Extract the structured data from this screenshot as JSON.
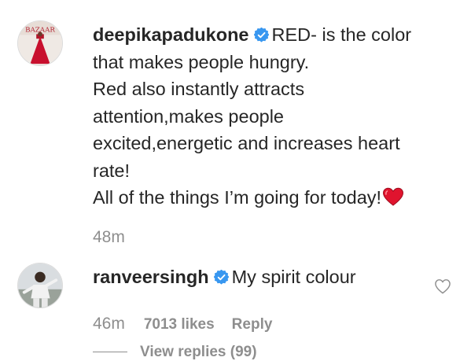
{
  "comments": [
    {
      "username": "deepikapadukone",
      "verified": true,
      "lines": [
        "RED- is the color",
        "that makes people hungry.",
        "Red also instantly attracts",
        "attention,makes people",
        "excited,energetic and increases heart",
        "rate!",
        "All of the things I’m going for today!"
      ],
      "emoji": "red-heart",
      "time": "48m",
      "avatar_text": "BAZAAR"
    },
    {
      "username": "ranveersingh",
      "verified": true,
      "text": "My spirit colour",
      "time": "46m",
      "likes": "7013 likes",
      "reply_label": "Reply",
      "view_replies": "View replies (99)"
    }
  ],
  "colors": {
    "text": "#262626",
    "meta": "#8e8e8e",
    "verified_badge": "#3897f0",
    "heart_emoji": "#e0142e"
  },
  "icons": {
    "verified": "verified-badge-icon",
    "like": "heart-outline-icon",
    "emoji": "red-heart-emoji"
  }
}
